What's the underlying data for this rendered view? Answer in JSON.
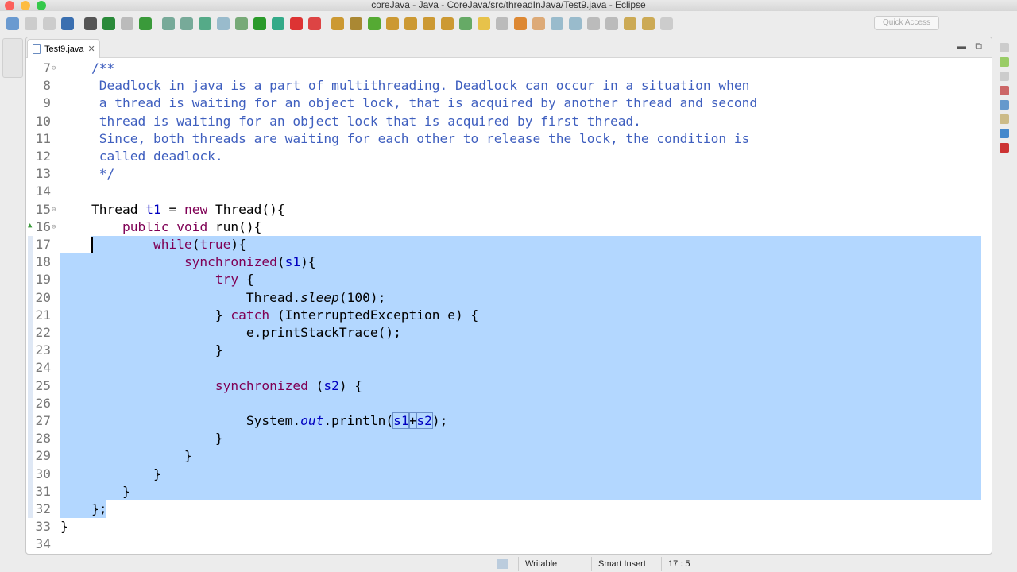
{
  "window": {
    "title": "coreJava - Java - CoreJava/src/threadInJava/Test9.java - Eclipse"
  },
  "toolbar": {
    "quick_access": "Quick Access"
  },
  "editor": {
    "tab_label": "Test9.java",
    "first_line": 7,
    "lines": [
      [
        {
          "t": "    /**",
          "c": "cm"
        }
      ],
      [
        {
          "t": "     Deadlock in java is a part of multithreading. Deadlock can occur in a situation when",
          "c": "cm"
        }
      ],
      [
        {
          "t": "     a thread is waiting for an object lock, that is acquired by another thread and second",
          "c": "cm"
        }
      ],
      [
        {
          "t": "     thread is waiting for an object lock that is acquired by first thread.",
          "c": "cm"
        }
      ],
      [
        {
          "t": "     Since, both threads are waiting for each other to release the lock, the condition is",
          "c": "cm"
        }
      ],
      [
        {
          "t": "     called deadlock.",
          "c": "cm"
        }
      ],
      [
        {
          "t": "     */",
          "c": "cm"
        }
      ],
      [],
      [
        {
          "t": "    Thread ",
          "c": "tx"
        },
        {
          "t": "t1",
          "c": "fd"
        },
        {
          "t": " = ",
          "c": "tx"
        },
        {
          "t": "new",
          "c": "kw"
        },
        {
          "t": " Thread(){",
          "c": "tx"
        }
      ],
      [
        {
          "t": "        ",
          "c": "tx"
        },
        {
          "t": "public",
          "c": "kw"
        },
        {
          "t": " ",
          "c": "tx"
        },
        {
          "t": "void",
          "c": "kw"
        },
        {
          "t": " run(){",
          "c": "tx"
        }
      ],
      [
        {
          "t": "            ",
          "c": "tx"
        },
        {
          "t": "while",
          "c": "kw"
        },
        {
          "t": "(",
          "c": "tx"
        },
        {
          "t": "true",
          "c": "kw"
        },
        {
          "t": "){",
          "c": "tx"
        }
      ],
      [
        {
          "t": "                ",
          "c": "tx"
        },
        {
          "t": "synchronized",
          "c": "kw"
        },
        {
          "t": "(",
          "c": "tx"
        },
        {
          "t": "s1",
          "c": "fd"
        },
        {
          "t": "){",
          "c": "tx"
        }
      ],
      [
        {
          "t": "                    ",
          "c": "tx"
        },
        {
          "t": "try",
          "c": "kw"
        },
        {
          "t": " {",
          "c": "tx"
        }
      ],
      [
        {
          "t": "                        Thread.",
          "c": "tx"
        },
        {
          "t": "sleep",
          "c": "it"
        },
        {
          "t": "(100);",
          "c": "tx"
        }
      ],
      [
        {
          "t": "                    } ",
          "c": "tx"
        },
        {
          "t": "catch",
          "c": "kw"
        },
        {
          "t": " (InterruptedException e) {",
          "c": "tx"
        }
      ],
      [
        {
          "t": "                        e.printStackTrace();",
          "c": "tx"
        }
      ],
      [
        {
          "t": "                    }",
          "c": "tx"
        }
      ],
      [],
      [
        {
          "t": "                    ",
          "c": "tx"
        },
        {
          "t": "synchronized",
          "c": "kw"
        },
        {
          "t": " (",
          "c": "tx"
        },
        {
          "t": "s2",
          "c": "fd"
        },
        {
          "t": ") {",
          "c": "tx"
        }
      ],
      [],
      [
        {
          "t": "                        System.",
          "c": "tx"
        },
        {
          "t": "out",
          "c": "fi"
        },
        {
          "t": ".println(",
          "c": "tx"
        },
        {
          "t": "s1",
          "c": "fd"
        },
        {
          "t": "+",
          "c": "tx"
        },
        {
          "t": "s2",
          "c": "fd"
        },
        {
          "t": ");",
          "c": "tx"
        }
      ],
      [
        {
          "t": "                    }",
          "c": "tx"
        }
      ],
      [
        {
          "t": "                }",
          "c": "tx"
        }
      ],
      [
        {
          "t": "            }",
          "c": "tx"
        }
      ],
      [
        {
          "t": "        }",
          "c": "tx"
        }
      ],
      [
        {
          "t": "    };",
          "c": "tx"
        }
      ],
      [
        {
          "t": "}",
          "c": "tx"
        }
      ],
      []
    ]
  },
  "status": {
    "writable": "Writable",
    "insert_mode": "Smart Insert",
    "position": "17 : 5"
  }
}
